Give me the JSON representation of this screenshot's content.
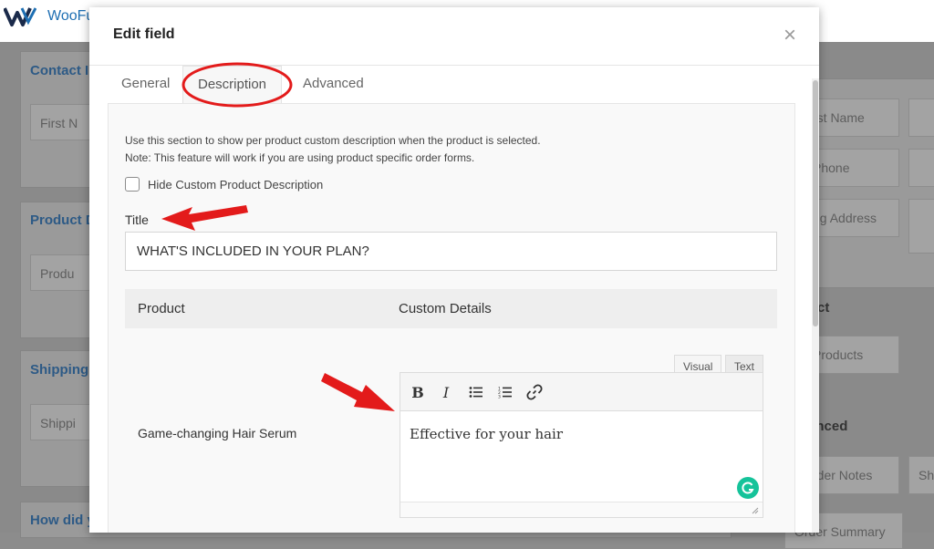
{
  "app": {
    "name": "WooFu",
    "colors": {
      "brand": "#1e6fb3",
      "annotation": "#e31b1b",
      "grammarly": "#15c39a"
    }
  },
  "background": {
    "sections": [
      {
        "heading": "Contact In",
        "field": "First N"
      },
      {
        "heading": "Product D",
        "field": "Produ"
      },
      {
        "heading": "Shipping",
        "field": "Shippi"
      },
      {
        "heading": "How did you discover us?"
      }
    ],
    "right_fields": [
      "rst Name",
      "Phone",
      "ng Address",
      "Products",
      "rder Notes",
      "Sh",
      "Order Summary"
    ],
    "right_headings": [
      "ct",
      "anced"
    ]
  },
  "modal": {
    "title": "Edit field",
    "close_label": "×",
    "tabs": [
      {
        "label": "General"
      },
      {
        "label": "Description"
      },
      {
        "label": "Advanced"
      }
    ],
    "active_tab": "Description",
    "description_line1": "Use this section to show per product custom description when the product is selected.",
    "description_line2": "Note: This feature will work if you are using product specific order forms.",
    "hide_checkbox_label": "Hide Custom Product Description",
    "hide_checkbox_checked": false,
    "title_label": "Title",
    "title_value": "WHAT'S INCLUDED IN YOUR PLAN?",
    "table": {
      "headers": [
        "Product",
        "Custom Details"
      ],
      "rows": [
        {
          "product": "Game-changing Hair Serum",
          "details": "Effective for your hair"
        }
      ]
    },
    "editor": {
      "tabs": [
        "Visual",
        "Text"
      ],
      "toolbar": [
        "bold",
        "italic",
        "bulleted-list",
        "numbered-list",
        "link"
      ],
      "bold_glyph": "B",
      "italic_glyph": "I"
    }
  }
}
